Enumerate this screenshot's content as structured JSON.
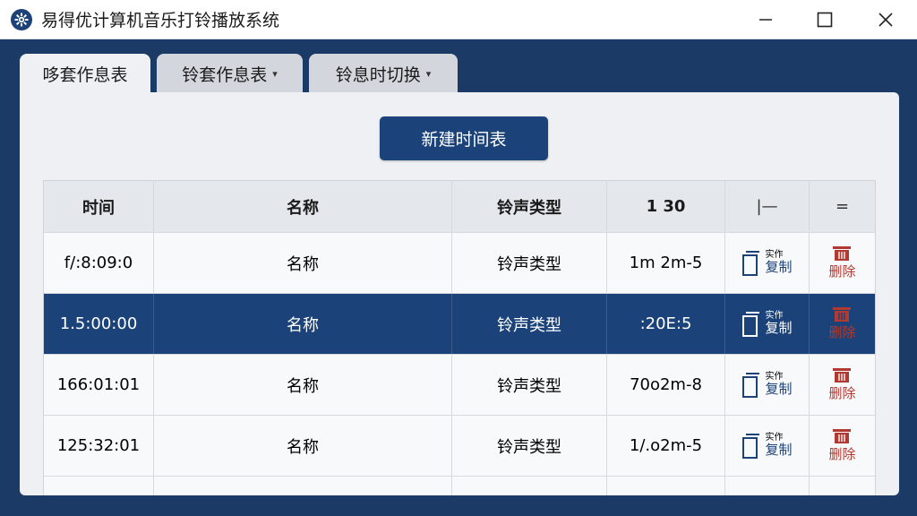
{
  "window": {
    "title": "易得优计算机音乐打铃播放系统"
  },
  "tabs": [
    {
      "label": "哆套作息表",
      "active": true
    },
    {
      "label": "铃套作息表",
      "caret": "▾",
      "active": false
    },
    {
      "label": "铃息时切换",
      "caret": "▾",
      "active": false
    }
  ],
  "toolbar": {
    "new_label": "新建时间表"
  },
  "table": {
    "headers": [
      "时间",
      "名称",
      "铃声类型",
      "1 30",
      "|—",
      "="
    ],
    "rows": [
      {
        "time": "f/:8:09:0",
        "name": "名称",
        "type": "铃声类型",
        "duration": "1m 2m-5",
        "copy_small": "实作",
        "copy": "复制",
        "delete": "删除",
        "selected": false
      },
      {
        "time": "1.5:00:00",
        "name": "名称",
        "type": "铃声类型",
        "duration": ":20E:5",
        "copy_small": "实作",
        "copy": "复制",
        "delete": "删除",
        "selected": true
      },
      {
        "time": "166:01:01",
        "name": "名称",
        "type": "铃声类型",
        "duration": "70o2m-8",
        "copy_small": "实作",
        "copy": "复制",
        "delete": "删除",
        "selected": false
      },
      {
        "time": "125:32:01",
        "name": "名称",
        "type": "铃声类型",
        "duration": "1/.o2m-5",
        "copy_small": "实作",
        "copy": "复制",
        "delete": "删除",
        "selected": false
      }
    ]
  },
  "colors": {
    "frame": "#1b3a66",
    "accent": "#1b4379",
    "delete": "#b03a32"
  }
}
